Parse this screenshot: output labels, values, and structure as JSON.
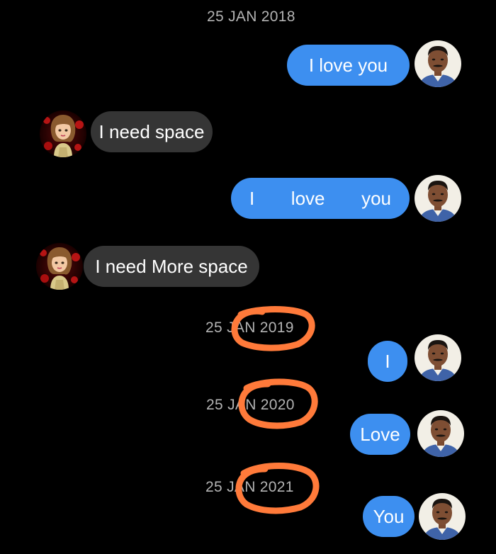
{
  "colors": {
    "background": "#000000",
    "sent_bubble": "#3d8ff0",
    "received_bubble": "#353535",
    "date_text": "#b3b3b3",
    "annotation": "#ff7a3a"
  },
  "messages": {
    "date_1": "25 JAN 2018",
    "sent_1": "I love you",
    "received_1": "I need space",
    "sent_2_words": [
      "I",
      "love",
      "you"
    ],
    "received_2": "I need More space",
    "date_2": "25 JAN 2019",
    "sent_3": "I",
    "date_3": "25 JAN 2020",
    "sent_4": "Love",
    "date_4": "25 JAN 2021",
    "sent_5": "You"
  },
  "avatars": {
    "sender": "man-avatar",
    "receiver": "bitmoji-woman-avatar"
  },
  "annotations": {
    "circled_years": [
      "2019",
      "2020",
      "2021"
    ],
    "style": "orange hand-drawn circle"
  }
}
